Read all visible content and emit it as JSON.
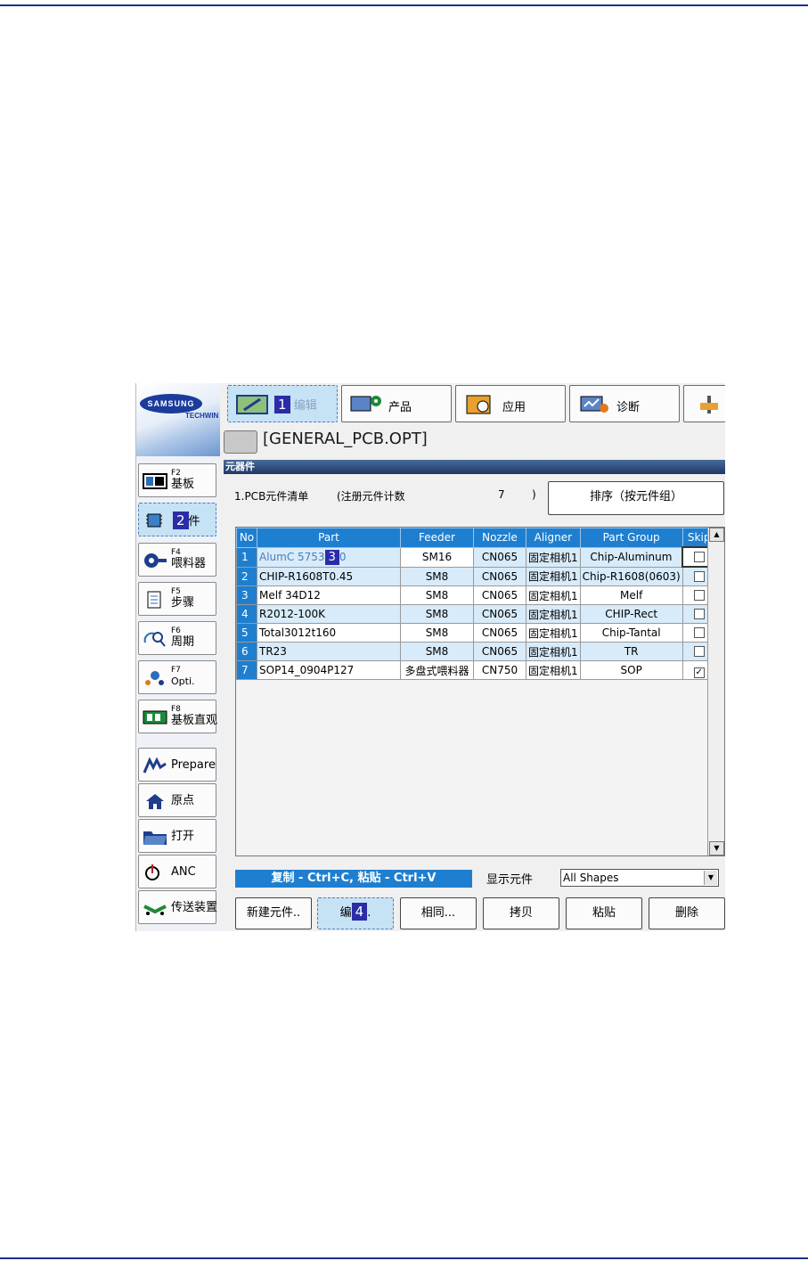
{
  "logo": {
    "brand": "SAMSUNG",
    "sub": "TECHWIN"
  },
  "tabs": [
    {
      "label": "编辑",
      "badge": "1"
    },
    {
      "label": "产品"
    },
    {
      "label": "应用"
    },
    {
      "label": "诊断"
    }
  ],
  "file": {
    "name": "[GENERAL_PCB.OPT]"
  },
  "section": {
    "title": "元器件"
  },
  "info": {
    "list_label": "1.PCB元件清单",
    "count_label": "(注册元件计数",
    "count": "7",
    "close": ")"
  },
  "sort_button": "排序（按元件组）",
  "sidebar": [
    {
      "key": "F2",
      "label": "基板"
    },
    {
      "key": "",
      "label": "件",
      "badge": "2"
    },
    {
      "key": "F4",
      "label": "喂料器"
    },
    {
      "key": "F5",
      "label": "步骤"
    },
    {
      "key": "F6",
      "label": "周期"
    },
    {
      "key": "F7",
      "label": "Opti."
    },
    {
      "key": "F8",
      "label": "基板直观"
    },
    {
      "key": "",
      "label": "Prepare"
    },
    {
      "key": "",
      "label": "原点"
    },
    {
      "key": "",
      "label": "打开"
    },
    {
      "key": "",
      "label": "ANC"
    },
    {
      "key": "",
      "label": "传送装置"
    }
  ],
  "table": {
    "headers": [
      "No",
      "Part",
      "Feeder",
      "Nozzle",
      "Aligner",
      "Part Group",
      "Skip"
    ],
    "badge3": "3",
    "rows": [
      {
        "no": "1",
        "part_a": "AlumC 5753",
        "part_b": "0",
        "feeder": "SM16",
        "nozzle": "CN065",
        "aligner": "固定相机1",
        "group": "Chip-Aluminum",
        "skip": ""
      },
      {
        "no": "2",
        "part": "CHIP-R1608T0.45",
        "feeder": "SM8",
        "nozzle": "CN065",
        "aligner": "固定相机1",
        "group": "Chip-R1608(0603)",
        "skip": ""
      },
      {
        "no": "3",
        "part": "Melf 34D12",
        "feeder": "SM8",
        "nozzle": "CN065",
        "aligner": "固定相机1",
        "group": "Melf",
        "skip": ""
      },
      {
        "no": "4",
        "part": "R2012-100K",
        "feeder": "SM8",
        "nozzle": "CN065",
        "aligner": "固定相机1",
        "group": "CHIP-Rect",
        "skip": ""
      },
      {
        "no": "5",
        "part": "Total3012t160",
        "feeder": "SM8",
        "nozzle": "CN065",
        "aligner": "固定相机1",
        "group": "Chip-Tantal",
        "skip": ""
      },
      {
        "no": "6",
        "part": "TR23",
        "feeder": "SM8",
        "nozzle": "CN065",
        "aligner": "固定相机1",
        "group": "TR",
        "skip": ""
      },
      {
        "no": "7",
        "part": "SOP14_0904P127",
        "feeder": "多盘式喂料器",
        "nozzle": "CN750",
        "aligner": "固定相机1",
        "group": "SOP",
        "skip": "✓"
      }
    ]
  },
  "copy_hint": "复制 - Ctrl+C, 粘贴 - Ctrl+V",
  "show": {
    "label": "显示元件",
    "value": "All Shapes"
  },
  "buttons": [
    {
      "label": "新建元件.."
    },
    {
      "label_a": "编",
      "badge": "4",
      "label_b": "."
    },
    {
      "label": "相同..."
    },
    {
      "label": "拷贝"
    },
    {
      "label": "粘贴"
    },
    {
      "label": "删除"
    }
  ],
  "colors": {
    "accent": "#1e7fd0",
    "selected": "#c6e2f5",
    "rule": "#1a2f8a",
    "badge": "#2c2ca8"
  }
}
